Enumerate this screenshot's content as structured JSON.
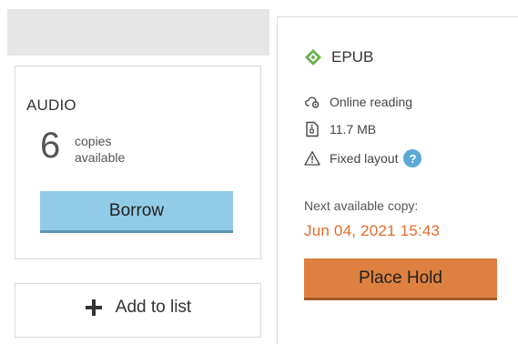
{
  "audio_card": {
    "format": "AUDIO",
    "copies_count": "6",
    "copies_text": "copies\navailable",
    "borrow_label": "Borrow",
    "borrow_color": "#92cbe8"
  },
  "add_to_list": {
    "icon": "plus-icon",
    "label": "Add to list"
  },
  "epub_card": {
    "format": "EPUB",
    "format_icon": "epub-diamond-icon",
    "features": [
      {
        "icon": "cloud-icon",
        "label": "Online reading"
      },
      {
        "icon": "file-size-icon",
        "label": "11.7 MB"
      },
      {
        "icon": "warning-icon",
        "label": "Fixed layout",
        "help": "?"
      }
    ],
    "next_available_label": "Next available copy:",
    "next_available_date": "Jun 04, 2021 15:43",
    "next_available_date_color": "#e26b2b",
    "place_hold_label": "Place Hold",
    "place_hold_color": "#dd8040"
  }
}
